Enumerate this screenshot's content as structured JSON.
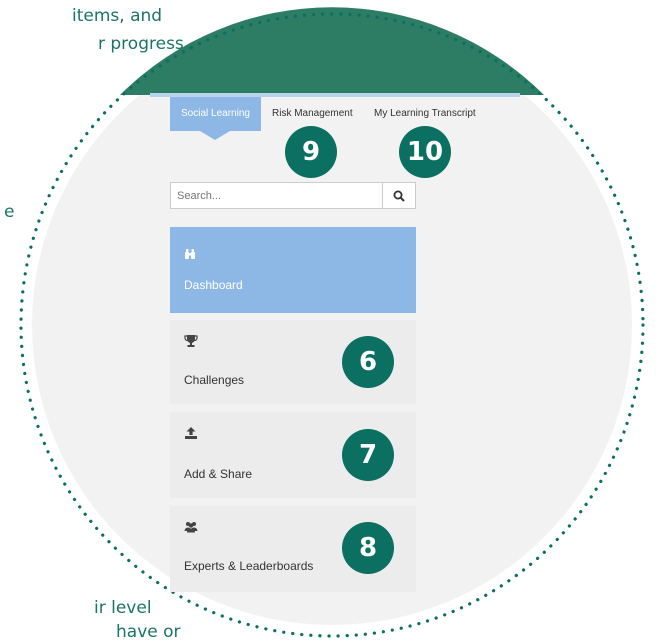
{
  "background_text": {
    "line1": "items, and",
    "line2": "r progress",
    "line3": "e",
    "line4": "ir level",
    "line5": "have or"
  },
  "tabs": [
    {
      "label": "Social Learning",
      "active": true
    },
    {
      "label": "Risk Management",
      "active": false
    },
    {
      "label": "My Learning Transcript",
      "active": false
    }
  ],
  "search": {
    "placeholder": "Search..."
  },
  "nav": [
    {
      "label": "Dashboard",
      "icon": "binoculars-icon",
      "active": true
    },
    {
      "label": "Challenges",
      "icon": "trophy-icon",
      "active": false
    },
    {
      "label": "Add & Share",
      "icon": "upload-icon",
      "active": false
    },
    {
      "label": "Experts & Leaderboards",
      "icon": "users-icon",
      "active": false
    }
  ],
  "callouts": {
    "challenges": "6",
    "add_share": "7",
    "experts": "8",
    "risk_management": "9",
    "learning_transcript": "10"
  },
  "colors": {
    "accent_green": "#2d7d64",
    "badge_green": "#0b6f61",
    "active_blue": "#8db8e6",
    "card_gray": "#ececec"
  }
}
